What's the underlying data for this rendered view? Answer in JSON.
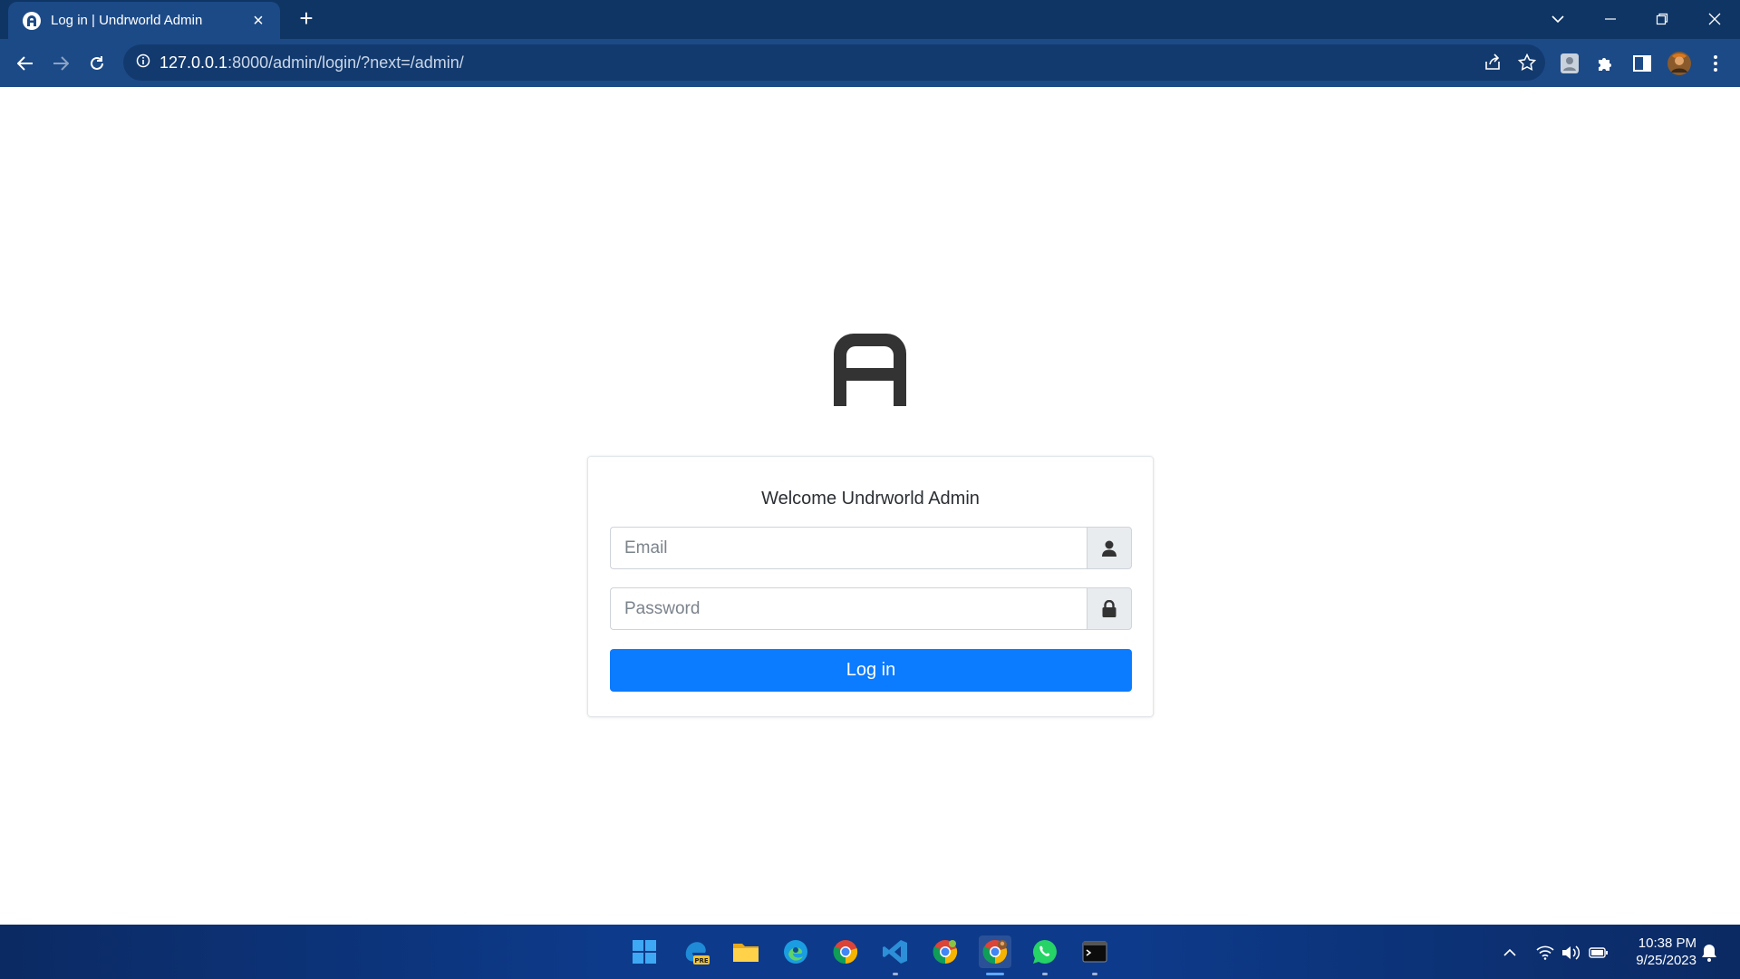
{
  "browser": {
    "tab_title": "Log in | Undrworld Admin",
    "tab_close": "×",
    "new_tab": "+",
    "url_host": "127.0.0.1",
    "url_rest": ":8000/admin/login/?next=/admin/"
  },
  "login": {
    "welcome": "Welcome Undrworld Admin",
    "email_placeholder": "Email",
    "password_placeholder": "Password",
    "login_label": "Log in"
  },
  "taskbar": {
    "apps": [
      "start-icon",
      "edge-preview-icon",
      "file-explorer-icon",
      "edge-icon",
      "chrome-icon",
      "vscode-icon",
      "chrome-canary-icon",
      "chrome-active-icon",
      "whatsapp-icon",
      "terminal-icon"
    ],
    "time": "10:38 PM",
    "date": "9/25/2023"
  },
  "colors": {
    "titlebar": "#0f3564",
    "toolbar": "#1c4a87",
    "primary_button": "#0b7bff",
    "taskbar": "#0d3a8a"
  }
}
